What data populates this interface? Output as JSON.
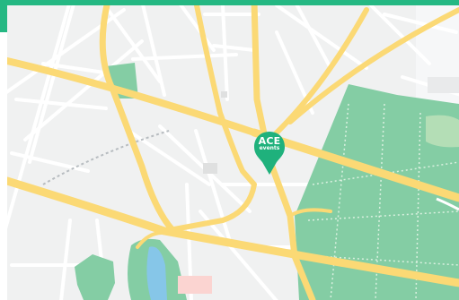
{
  "marker": {
    "brand": "ACE",
    "sub": "events"
  },
  "colors": {
    "accent": "#25b883",
    "marker": "#1fb17c",
    "road_major": "#fbd975",
    "road_minor": "#ffffff",
    "park": "#84cda4",
    "land": "#f0f1f1",
    "water": "#86c6e8",
    "building": "#dfe0e0",
    "pink_area": "#fbd4d1"
  },
  "icons": {
    "marker": "map-pin-icon"
  }
}
